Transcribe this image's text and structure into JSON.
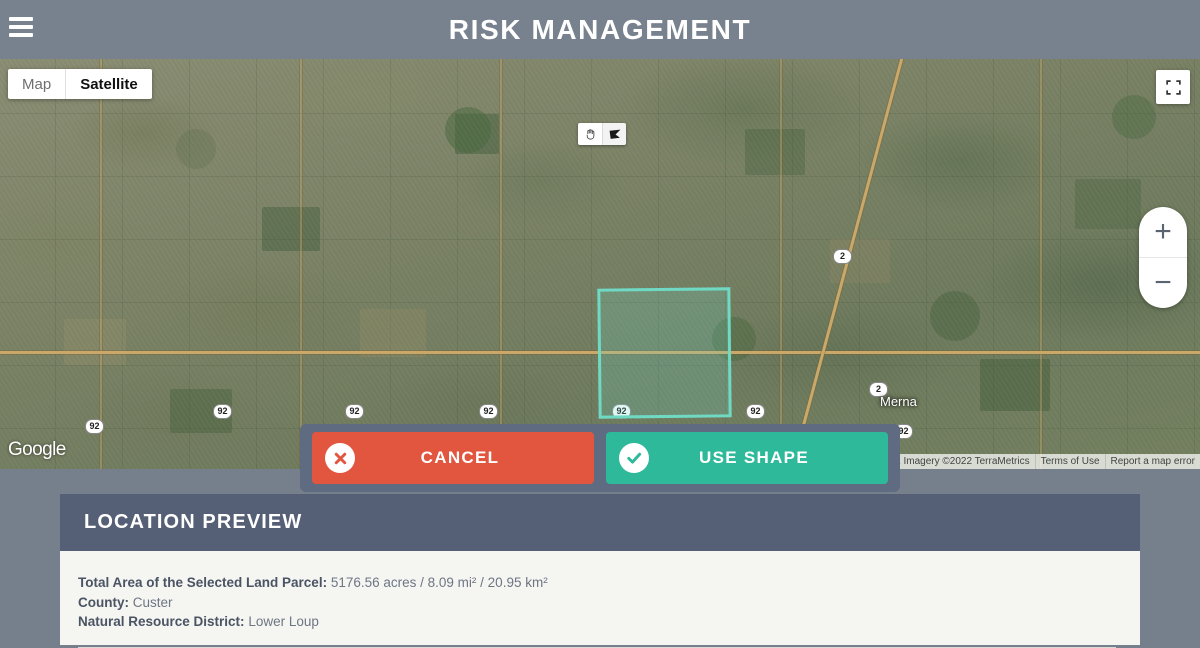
{
  "header": {
    "title": "RISK MANAGEMENT",
    "menu_icon": "hamburger-menu-icon"
  },
  "map": {
    "maptype": {
      "map_label": "Map",
      "satellite_label": "Satellite",
      "active": "Satellite"
    },
    "tools": {
      "pan_icon": "hand-pan-icon",
      "shape_icon": "polygon-draw-icon"
    },
    "fullscreen_icon": "fullscreen-icon",
    "zoom": {
      "zoom_in_label": "+",
      "zoom_out_label": "−"
    },
    "provider_logo": "Google",
    "town_label": "Merna",
    "highway_shields": [
      "92",
      "92",
      "92",
      "92",
      "92",
      "92",
      "2",
      "2",
      "92"
    ],
    "attribution": [
      "Map data ©2022 Imagery ©2022 TerraMetrics",
      "Terms of Use",
      "Report a map error"
    ],
    "selection": {
      "shape": "polygon",
      "stroke_color": "#6fd9c4",
      "fill_color": "rgba(110,215,196,0.22)"
    }
  },
  "actions": {
    "cancel": {
      "label": "CANCEL",
      "icon": "close-circle-icon",
      "color": "#e2563f"
    },
    "use_shape": {
      "label": "USE SHAPE",
      "icon": "check-circle-icon",
      "color": "#2fb99b"
    }
  },
  "location_preview": {
    "title": "LOCATION PREVIEW",
    "fields": [
      {
        "label": "Total Area of the Selected Land Parcel:",
        "value": "5176.56 acres / 8.09 mi² / 20.95 km²"
      },
      {
        "label": "County:",
        "value": "Custer"
      },
      {
        "label": "Natural Resource District:",
        "value": "Lower Loup"
      }
    ]
  },
  "theme": {
    "appbar_bg": "#78828e",
    "card_header_bg": "#555f75",
    "card_body_bg": "#f5f5f2",
    "page_bg": "#76808c"
  }
}
